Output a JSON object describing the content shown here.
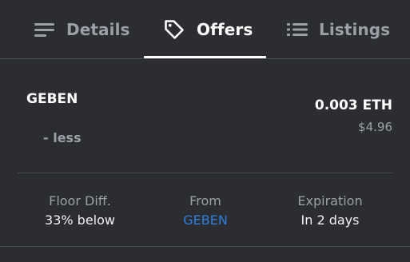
{
  "tabs": {
    "details": {
      "label": "Details",
      "icon": "menu-lines-icon"
    },
    "offers": {
      "label": "Offers",
      "icon": "tag-icon",
      "active": true
    },
    "listings": {
      "label": "Listings",
      "icon": "list-icon"
    }
  },
  "offer": {
    "name": "GEBEN",
    "quantity_text": "- less",
    "price": "0.003 ETH",
    "usd": "$4.96",
    "meta": {
      "floor_diff_label": "Floor Diff.",
      "floor_diff_value": "33% below",
      "from_label": "From",
      "from_value": "GEBEN",
      "expiration_label": "Expiration",
      "expiration_value": "In 2 days"
    }
  },
  "colors": {
    "background": "#2b2d31",
    "text_primary": "#ffffff",
    "text_muted": "#9aa0a6",
    "link": "#2f7fe0",
    "divider": "#45494f"
  }
}
